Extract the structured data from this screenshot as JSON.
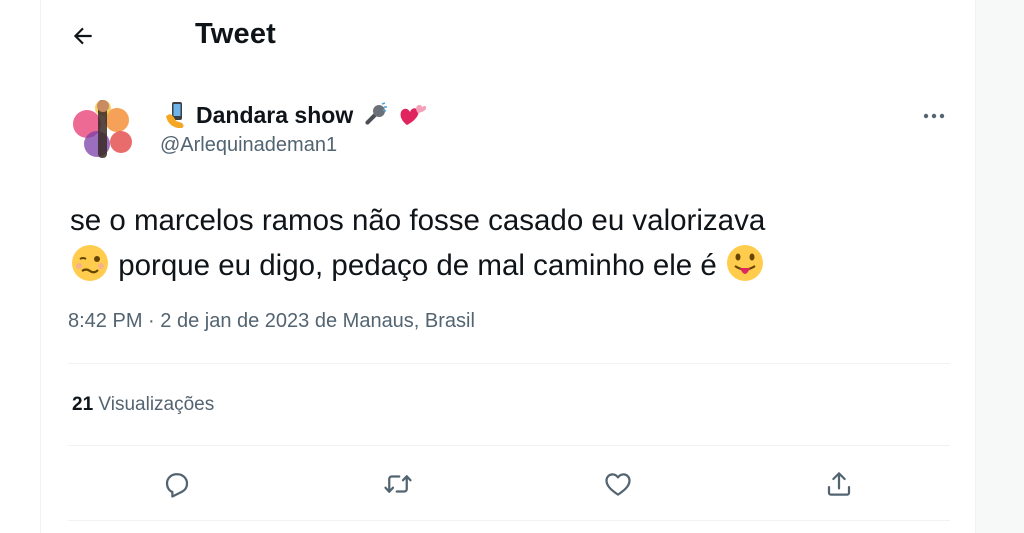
{
  "header": {
    "back_icon": "arrow-left-icon",
    "title": "Tweet"
  },
  "author": {
    "display_name": "Dandara show",
    "handle": "@Arlequinademan1",
    "name_emojis": [
      "microphone-emoji",
      "heart-emoji"
    ],
    "prefix_emoji": "phone-emoji"
  },
  "tweet": {
    "line1": "se o marcelos ramos não fosse casado eu valorizava",
    "line2": " porque eu digo, pedaço de mal caminho ele é ",
    "time": "8:42 PM",
    "separator": " · ",
    "date": "2 de jan de 2023",
    "location_prefix": " de ",
    "location": "Manaus, Brasil"
  },
  "stats": {
    "views_count": "21",
    "views_label": " Visualizações"
  },
  "actions": [
    {
      "name": "reply",
      "icon": "reply-icon"
    },
    {
      "name": "retweet",
      "icon": "retweet-icon"
    },
    {
      "name": "like",
      "icon": "heart-icon"
    },
    {
      "name": "share",
      "icon": "share-icon"
    }
  ],
  "colors": {
    "text": "#0f1419",
    "secondary": "#536471",
    "border": "#eff3f4"
  }
}
